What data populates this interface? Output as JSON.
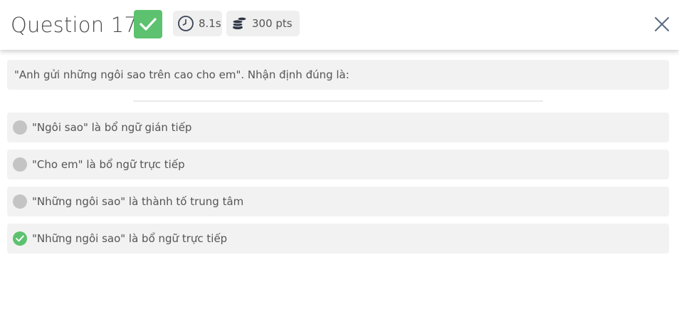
{
  "header": {
    "title": "Question 17",
    "status_icon": "check-icon",
    "time": {
      "icon": "clock-icon",
      "value": "8.1s"
    },
    "points": {
      "icon": "coins-icon",
      "value": "300 pts"
    },
    "close_icon": "close-icon"
  },
  "question": {
    "text": "\"Anh gửi những ngôi sao trên cao cho em\". Nhận định đúng là:"
  },
  "options": [
    {
      "text": "\"Ngôi sao\" là bổ ngữ gián tiếp",
      "correct": false
    },
    {
      "text": "\"Cho em\" là bổ ngữ trực tiếp",
      "correct": false
    },
    {
      "text": "\"Những ngôi sao\" là thành tố trung tâm",
      "correct": false
    },
    {
      "text": "\"Những ngôi sao\" là bổ ngữ trực tiếp",
      "correct": true
    }
  ],
  "colors": {
    "correct_green": "#5cc26f",
    "option_bg": "#f2f2f2",
    "neutral_radio": "#c4c4c4"
  }
}
